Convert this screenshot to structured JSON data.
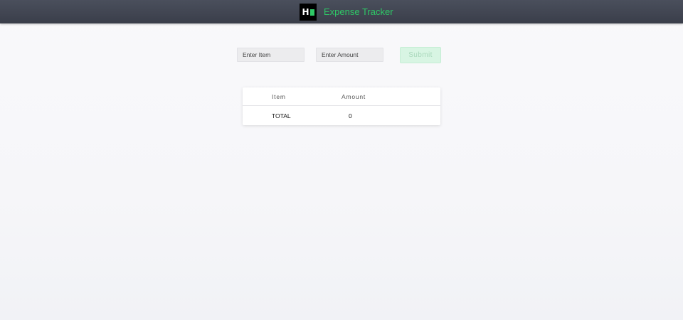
{
  "header": {
    "title": "Expense Tracker",
    "logo_letter": "H"
  },
  "form": {
    "item_placeholder": "Enter Item",
    "item_value": "",
    "amount_placeholder": "Enter Amount",
    "amount_value": "",
    "submit_label": "Submit"
  },
  "table": {
    "columns": [
      "Item",
      "Amount"
    ],
    "rows": [],
    "total_label": "TOTAL",
    "total_value": "0"
  },
  "colors": {
    "accent": "#2ec866",
    "header_bg": "#3f4350"
  },
  "icons": {
    "logo": "brand-logo-icon"
  }
}
